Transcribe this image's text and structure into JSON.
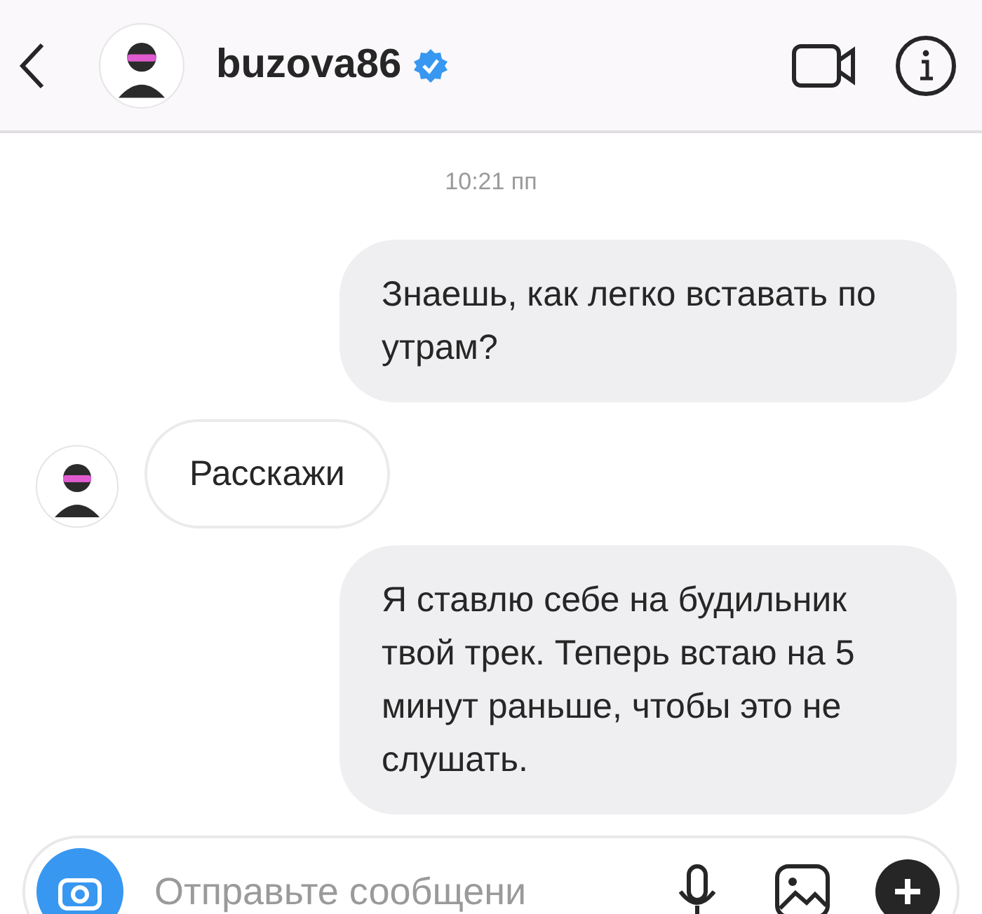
{
  "header": {
    "username": "buzova86",
    "verified": true
  },
  "timestamp": "10:21 пп",
  "messages": [
    {
      "kind": "outgoing",
      "text": "Знаешь, как легко вставать по утрам?"
    },
    {
      "kind": "incoming",
      "text": "Расскажи"
    },
    {
      "kind": "outgoing",
      "text": "Я ставлю себе на будильник твой трек. Теперь встаю на 5 минут раньше, чтобы это не слушать."
    }
  ],
  "composer": {
    "placeholder": "Отправьте сообщени"
  }
}
